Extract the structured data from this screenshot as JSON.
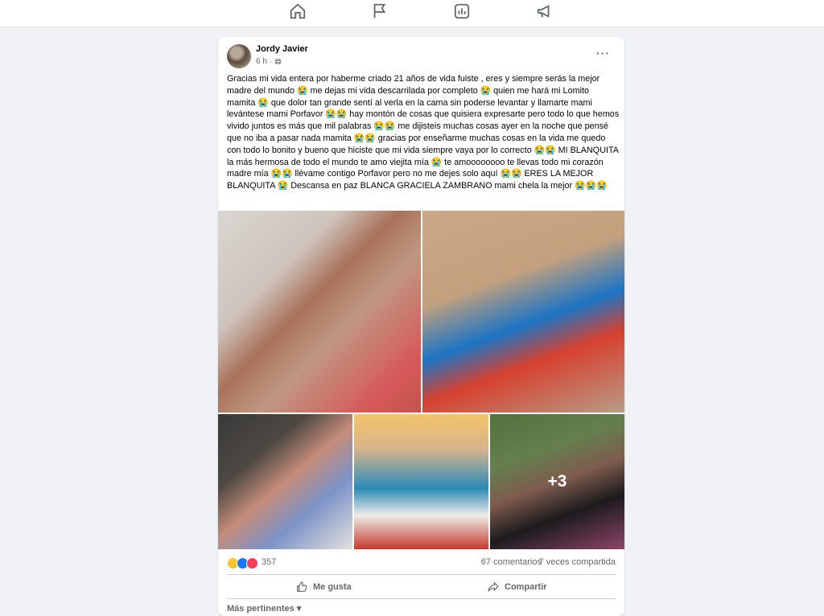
{
  "nav": {
    "icons": [
      "home-icon",
      "flag-icon",
      "chart-icon",
      "megaphone-icon"
    ]
  },
  "post": {
    "author": "Jordy Javier",
    "time": "6 h ·",
    "more": "···",
    "text": "Gracias mi vida entera por haberme criado 21 años  de vida fuiste , eres y siempre serás la mejor madre del mundo 😭 me dejas mi vida descarrilada por completo 😭 quien me hará mi Lomito mamita 😭 que dolor tan grande sentí al verla en la cama sin poderse levantar y llamarte mami levántese mami Porfavor 😭😭 hay montón de cosas que quisiera expresarte pero todo lo que hemos vivido juntos es más que mil palabras 😭😭 me dijisteis muchas cosas ayer en la noche que pensé que no iba a pasar nada mamita 😭😭 gracias por enseñarme muchas cosas en la vida me quedo con todo lo bonito y bueno que hiciste que mi vida siempre vaya por lo correcto 😭😭 MI BLANQUITA la más hermosa de todo el mundo te amo viejita mía 😭 te amoooooooo te llevas todo mi corazón madre mía 😭😭 llévame contigo Porfavor pero no me dejes solo aquí 😭😭 ERES LA MEJOR BLANQUITA 😭 Descansa en paz BLANCA GRACIELA ZAMBRANO mami chela la mejor 😭😭😭",
    "extra_photos": "+3",
    "reaction_count": "357",
    "comments": "67 comentarios",
    "shares": "7 veces compartida",
    "like_label": "Me gusta",
    "share_label": "Compartir",
    "sort_label": "Más pertinentes ▾"
  },
  "colors": {
    "background": "#f0f2f5",
    "card": "#ffffff",
    "secondary_text": "#65676b",
    "like_blue": "#1877f2",
    "love_red": "#f33e58",
    "sad_yellow": "#f7c531"
  }
}
